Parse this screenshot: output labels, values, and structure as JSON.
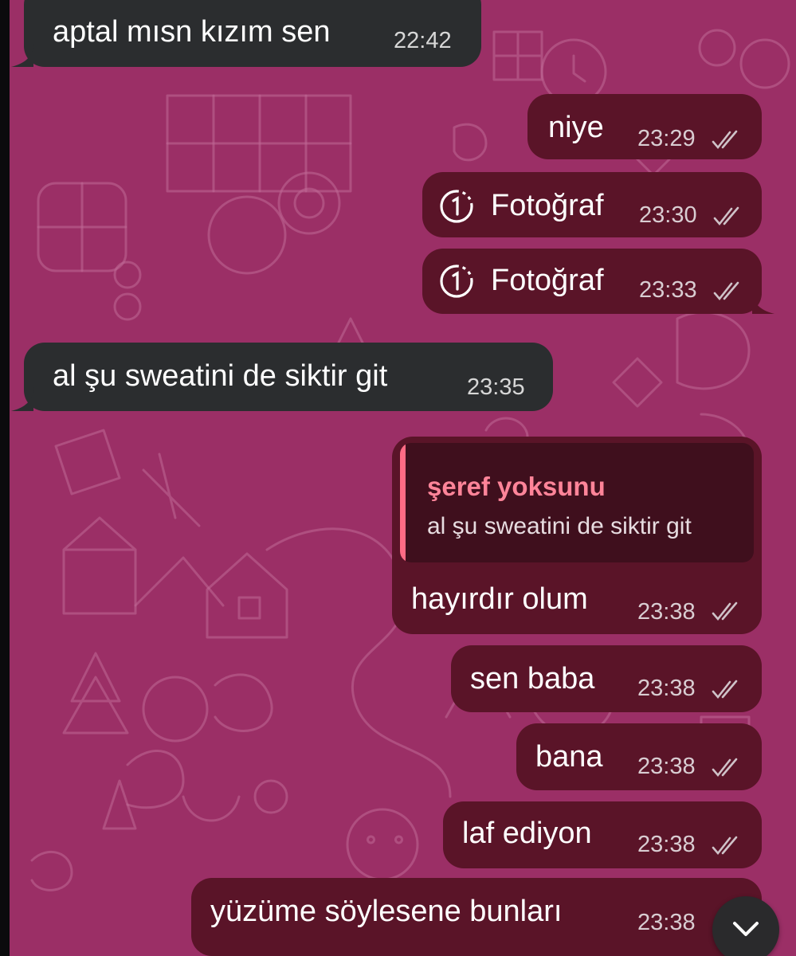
{
  "messages": [
    {
      "text": "aptal mısn kızım sen",
      "time": "22:42",
      "direction": "incoming"
    },
    {
      "text": "niye",
      "time": "23:29",
      "direction": "outgoing",
      "status": "read"
    },
    {
      "text": "Fotoğraf",
      "time": "23:30",
      "direction": "outgoing",
      "status": "read",
      "icon": "view-once-icon"
    },
    {
      "text": "Fotoğraf",
      "time": "23:33",
      "direction": "outgoing",
      "status": "read",
      "icon": "view-once-icon"
    },
    {
      "text": "al şu sweatini de siktir git",
      "time": "23:35",
      "direction": "incoming"
    },
    {
      "text": "hayırdır olum",
      "time": "23:38",
      "direction": "outgoing",
      "status": "read",
      "reply": {
        "name": "şeref yoksunu",
        "text": "al şu sweatini de siktir git"
      }
    },
    {
      "text": "sen baba",
      "time": "23:38",
      "direction": "outgoing",
      "status": "read"
    },
    {
      "text": "bana",
      "time": "23:38",
      "direction": "outgoing",
      "status": "read"
    },
    {
      "text": "laf ediyon",
      "time": "23:38",
      "direction": "outgoing",
      "status": "read"
    },
    {
      "text": "yüzüme söylesene bunları",
      "time": "23:38",
      "direction": "outgoing",
      "status": "read"
    }
  ],
  "colors": {
    "wallpaper": "#9b2f66",
    "incoming_bubble": "#2b2d2f",
    "outgoing_bubble": "#5a1428",
    "reply_accent": "#ff6b85"
  },
  "icons": {
    "read_status": "double-check-icon",
    "scroll_down": "chevron-down-icon"
  }
}
